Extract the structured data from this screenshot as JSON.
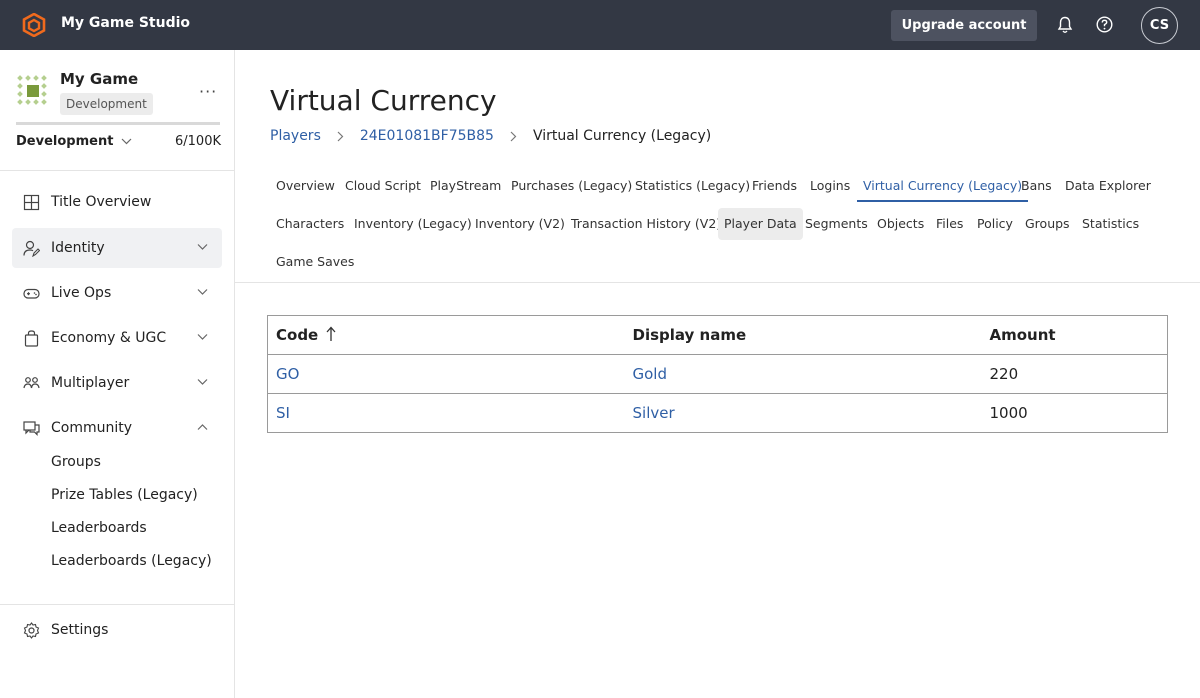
{
  "header": {
    "app_title": "My Game Studio",
    "upgrade_label": "Upgrade account",
    "avatar_initials": "CS",
    "logo_color": "#f06a1d"
  },
  "sidebar": {
    "game_name": "My Game",
    "env_badge": "Development",
    "env_select": "Development",
    "usage": "6/100K",
    "nav": [
      {
        "label": "Title Overview",
        "icon": "grid-icon"
      },
      {
        "label": "Identity",
        "icon": "identity-icon",
        "active": true
      },
      {
        "label": "Live Ops",
        "icon": "gamepad-icon"
      },
      {
        "label": "Economy & UGC",
        "icon": "bag-icon"
      },
      {
        "label": "Multiplayer",
        "icon": "people-icon"
      },
      {
        "label": "Community",
        "icon": "chat-icon",
        "expanded": true
      }
    ],
    "community_sub": [
      "Groups",
      "Prize Tables (Legacy)",
      "Leaderboards",
      "Leaderboards (Legacy)"
    ],
    "settings": "Settings"
  },
  "main": {
    "title": "Virtual Currency",
    "breadcrumb": [
      "Players",
      "24E01081BF75B85",
      "Virtual Currency (Legacy)"
    ],
    "tabs": [
      "Overview",
      "Cloud Script",
      "PlayStream",
      "Purchases (Legacy)",
      "Statistics (Legacy)",
      "Friends",
      "Logins",
      "Virtual Currency (Legacy)",
      "Bans",
      "Data Explorer",
      "Characters",
      "Inventory (Legacy)",
      "Inventory (V2)",
      "Transaction History (V2)",
      "Player Data",
      "Segments",
      "Objects",
      "Files",
      "Policy",
      "Groups",
      "Statistics",
      "Game Saves"
    ],
    "active_tab": "Virtual Currency (Legacy)",
    "table": {
      "headers": [
        "Code",
        "Display name",
        "Amount"
      ],
      "rows": [
        [
          "GO",
          "Gold",
          "220"
        ],
        [
          "SI",
          "Silver",
          "1000"
        ]
      ]
    }
  },
  "colors": {
    "topbar": "#333844",
    "link": "#2f5fa5"
  }
}
